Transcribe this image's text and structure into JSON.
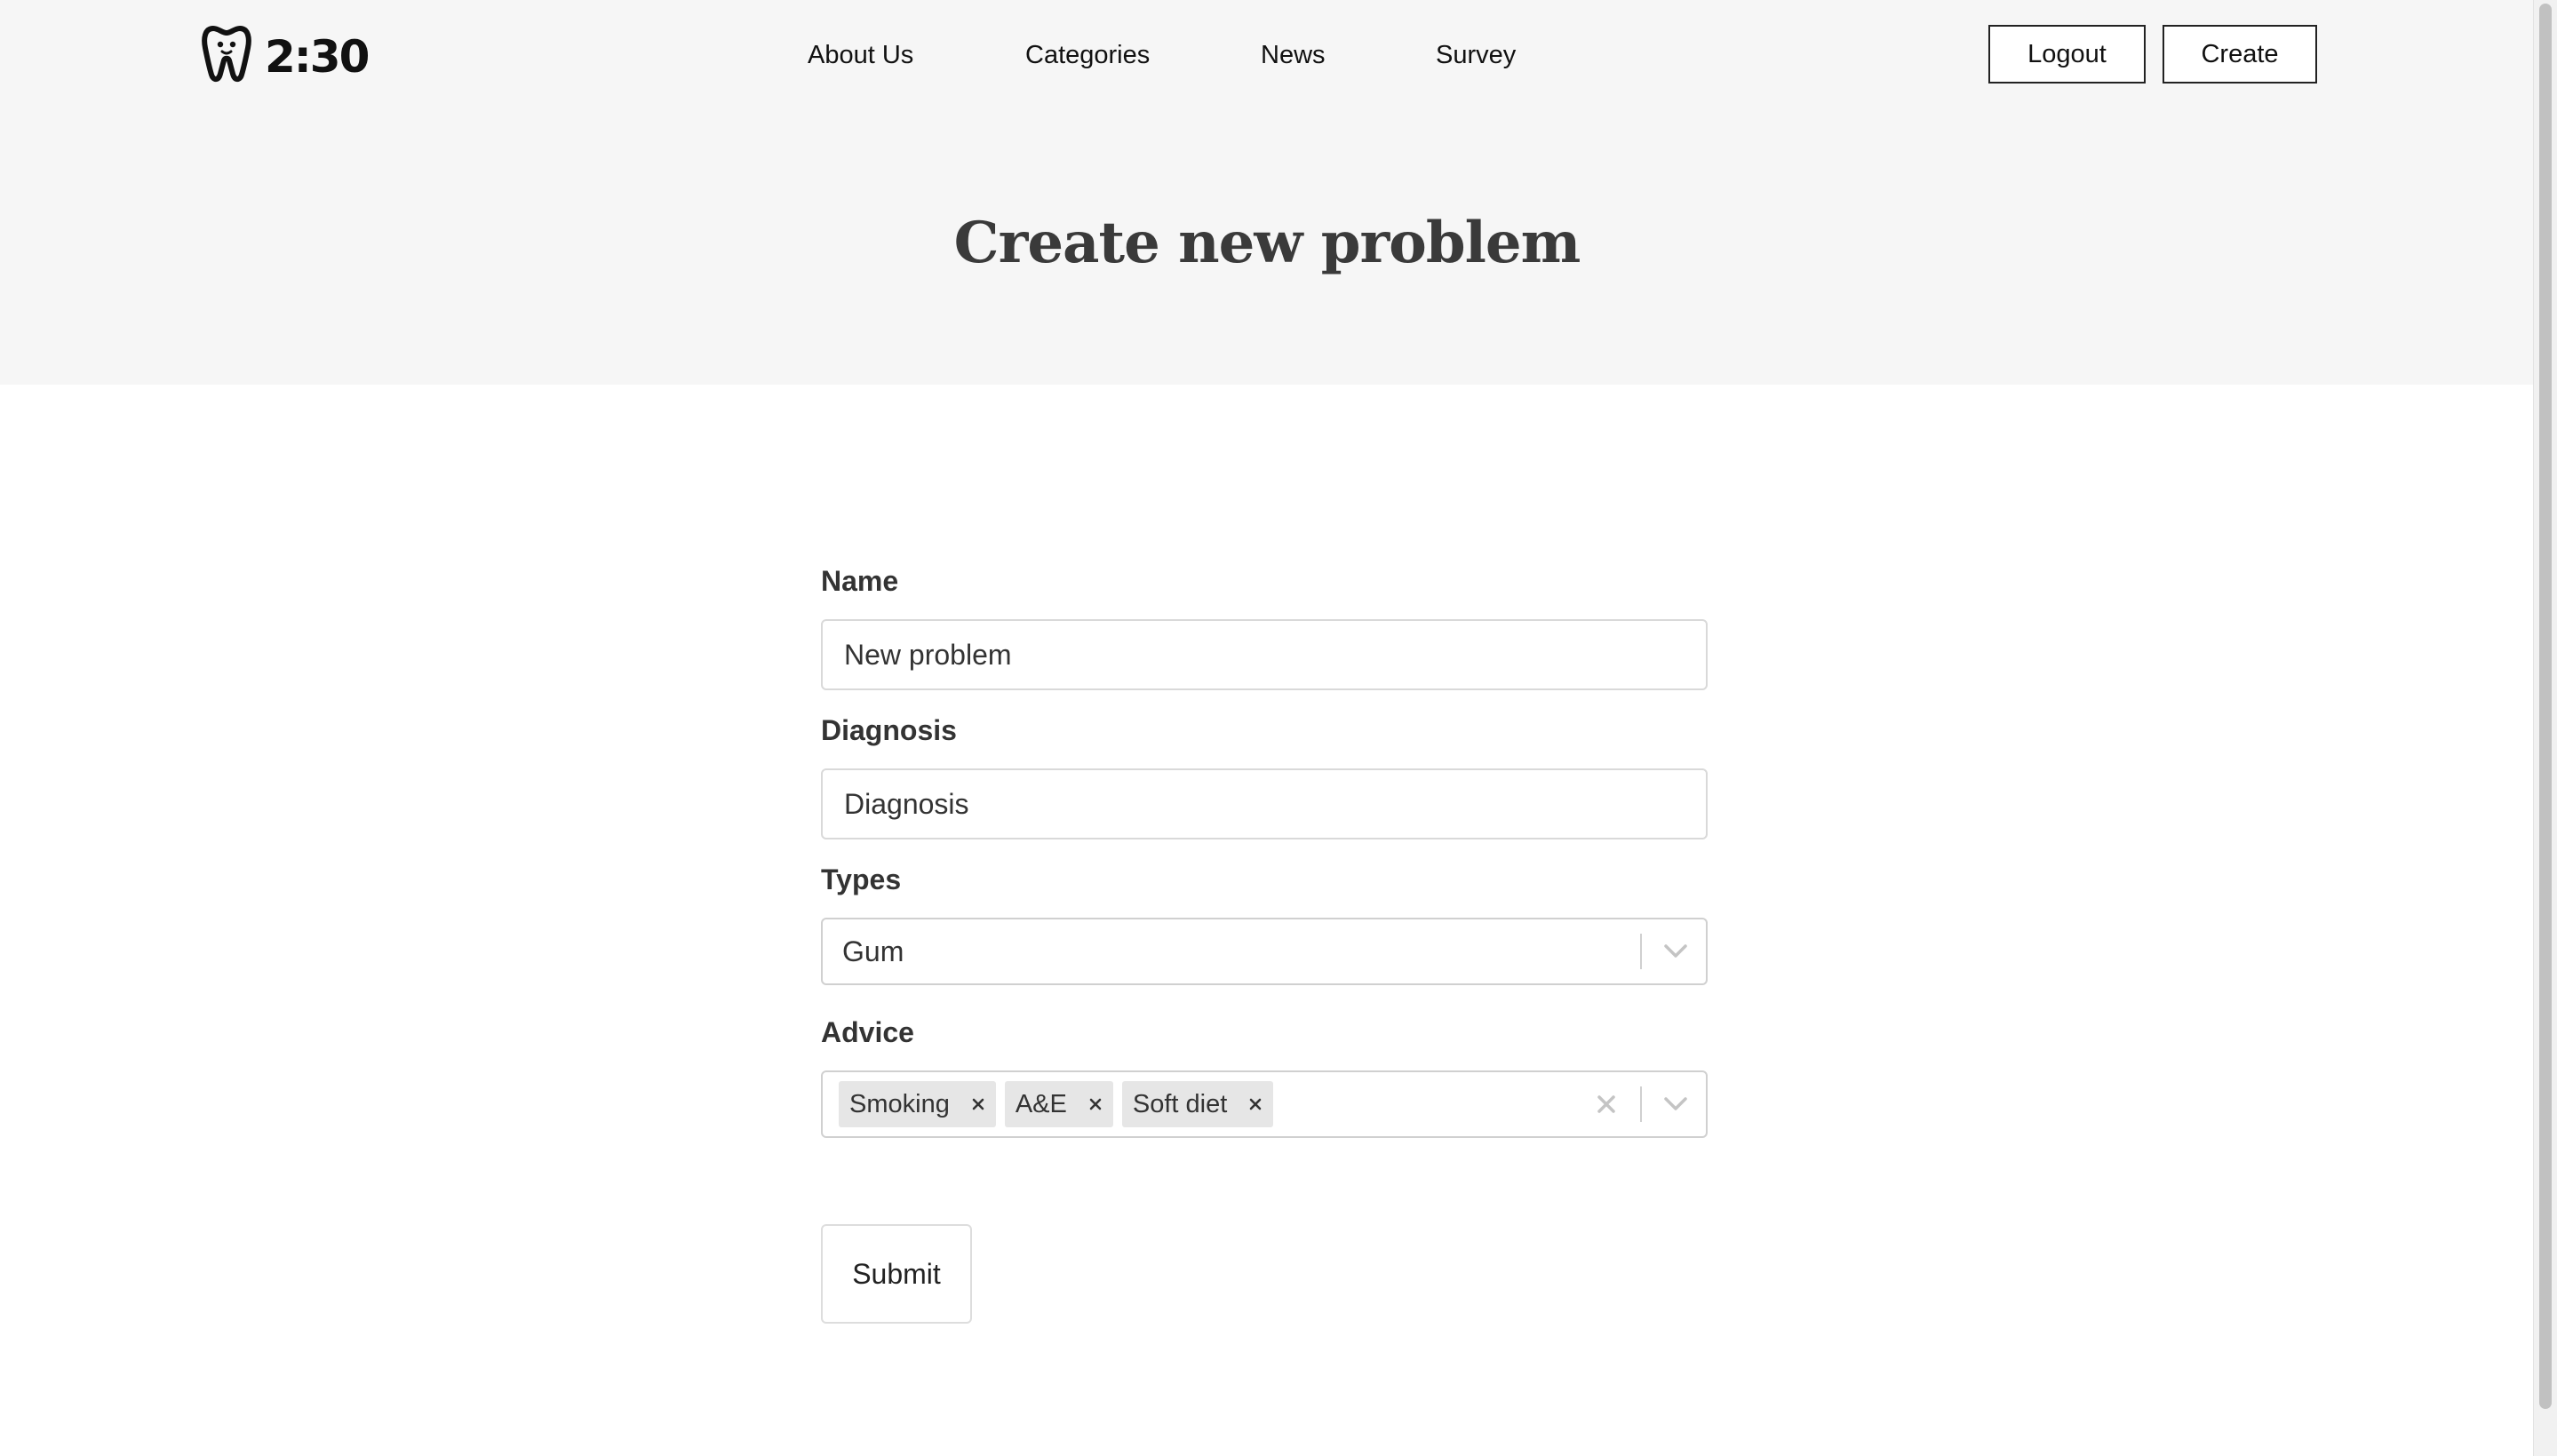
{
  "header": {
    "logo_text": "2:30",
    "logo_icon": "tooth-icon",
    "nav": [
      "About Us",
      "Categories",
      "News",
      "Survey"
    ],
    "logout_label": "Logout",
    "create_label": "Create"
  },
  "page": {
    "title": "Create new problem"
  },
  "form": {
    "name": {
      "label": "Name",
      "value": "New problem"
    },
    "diagnosis": {
      "label": "Diagnosis",
      "value": "Diagnosis"
    },
    "types": {
      "label": "Types",
      "selected": "Gum"
    },
    "advice": {
      "label": "Advice",
      "selected": [
        "Smoking",
        "A&E",
        "Soft diet"
      ]
    },
    "submit_label": "Submit"
  },
  "colors": {
    "hero_background": "#f6f6f6",
    "chip_background": "#e6e6e6",
    "title_color": "#3a3a3a"
  }
}
